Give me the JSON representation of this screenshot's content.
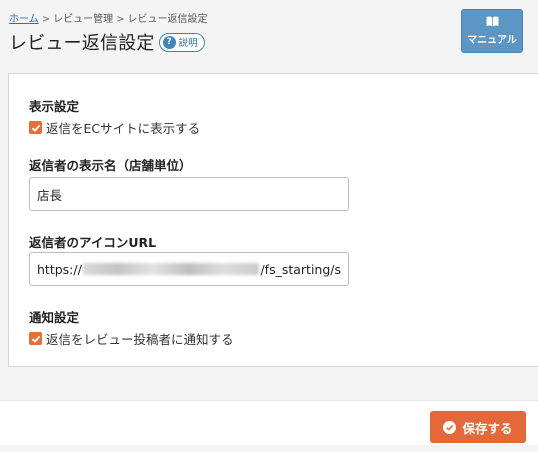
{
  "breadcrumb": {
    "home": "ホーム",
    "sep1": ">",
    "item2": "レビュー管理",
    "sep2": ">",
    "item3": "レビュー返信設定"
  },
  "header": {
    "title": "レビュー返信設定",
    "help_label": "説明",
    "help_icon": "question-circle-icon",
    "manual_label": "マニュアル",
    "manual_icon": "book-icon"
  },
  "form": {
    "display": {
      "label": "表示設定",
      "checkbox_label": "返信をECサイトに表示する",
      "checked": true
    },
    "replier_name": {
      "label": "返信者の表示名（店舗単位）",
      "value": "店長"
    },
    "icon_url": {
      "label": "返信者のアイコンURL",
      "value_prefix": "https://",
      "value_suffix": "/fs_starting/s"
    },
    "notify": {
      "label": "通知設定",
      "checkbox_label": "返信をレビュー投稿者に通知する",
      "checked": true
    }
  },
  "footer": {
    "save_label": "保存する",
    "save_icon": "check-circle-icon"
  },
  "colors": {
    "accent_orange": "#e4683a",
    "checkbox_orange": "#e2703a",
    "manual_blue": "#5b96c4",
    "help_blue": "#3f86b8",
    "link_blue": "#3a6ea8"
  }
}
